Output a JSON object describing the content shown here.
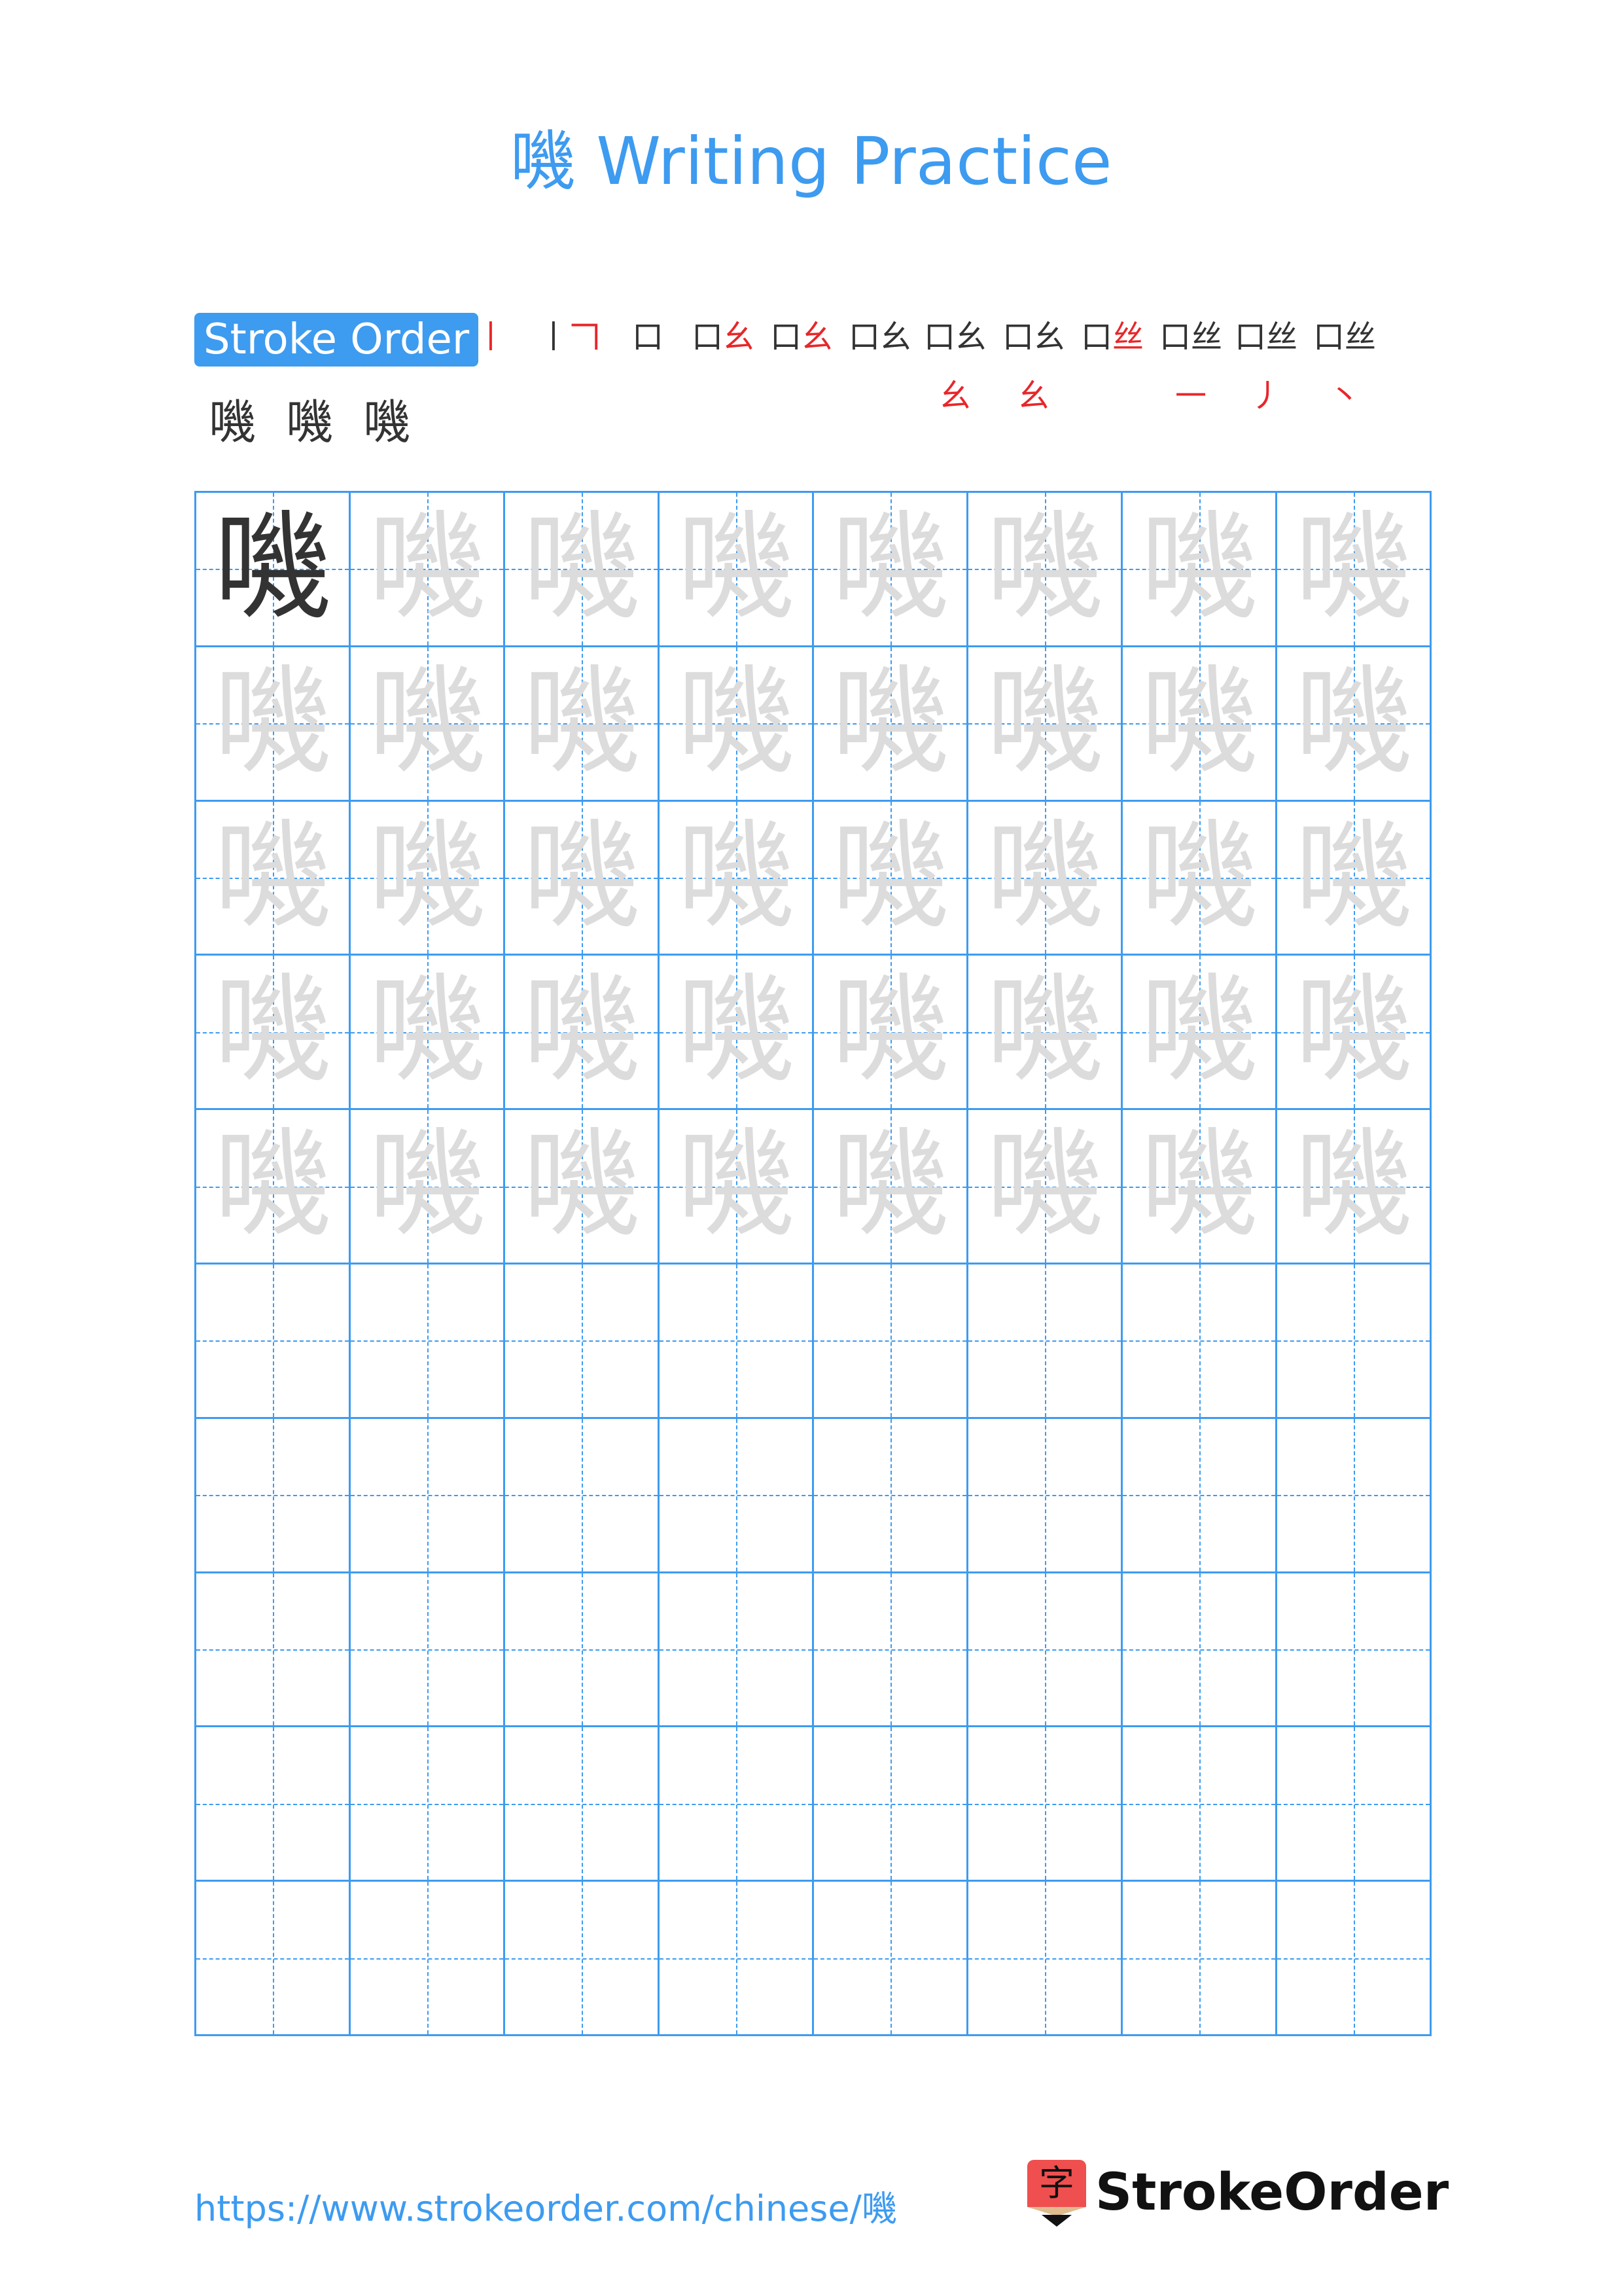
{
  "title": "嘰 Writing Practice",
  "character": "嘰",
  "stroke_order": {
    "label": "Stroke Order",
    "total_strokes": 15,
    "steps": [
      {
        "done": "",
        "new": "丨"
      },
      {
        "done": "丨",
        "new": "𠃍"
      },
      {
        "done": "口",
        "new": ""
      },
      {
        "done": "口",
        "new": "幺"
      },
      {
        "done": "口",
        "new": "幺"
      },
      {
        "done": "口幺",
        "new": ""
      },
      {
        "done": "口幺",
        "new": "幺"
      },
      {
        "done": "口幺",
        "new": "幺"
      },
      {
        "done": "口",
        "new": "丝"
      },
      {
        "done": "口丝",
        "new": "一"
      },
      {
        "done": "口丝",
        "new": "丿"
      },
      {
        "done": "口丝",
        "new": "丶"
      },
      {
        "done": "嘰",
        "new": ""
      },
      {
        "done": "嘰",
        "new": ""
      },
      {
        "done": "嘰",
        "new": ""
      }
    ]
  },
  "grid": {
    "columns": 8,
    "rows": 10,
    "model_cells": 1,
    "trace_rows": 5,
    "line_color": "#3d9bf0",
    "trace_color": "#dcdcdc",
    "model_color": "#333333"
  },
  "footer": {
    "url": "https://www.strokeorder.com/chinese/嘰",
    "logo_icon_char": "字",
    "logo_text": "StrokeOrder"
  },
  "colors": {
    "accent": "#3d9bf0",
    "highlight_stroke": "#e8262a",
    "logo_red": "#ef4f4f"
  }
}
